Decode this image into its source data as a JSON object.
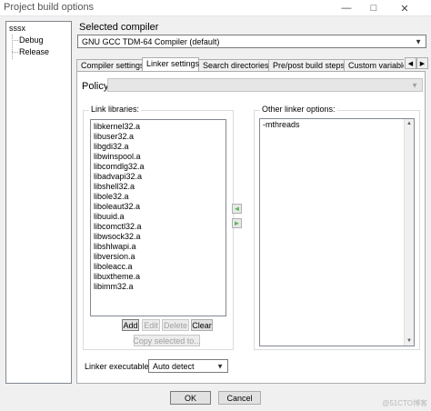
{
  "window": {
    "title": "Project build options"
  },
  "tree": {
    "root": "sssx",
    "children": [
      "Debug",
      "Release"
    ]
  },
  "compiler": {
    "label": "Selected compiler",
    "value": "GNU GCC TDM-64 Compiler (default)"
  },
  "tabs": [
    "Compiler settings",
    "Linker settings",
    "Search directories",
    "Pre/post build steps",
    "Custom variable"
  ],
  "active_tab": "Linker settings",
  "policy": {
    "label": "Policy:",
    "value": ""
  },
  "link_libraries": {
    "label": "Link libraries:",
    "items": [
      "libkernel32.a",
      "libuser32.a",
      "libgdi32.a",
      "libwinspool.a",
      "libcomdlg32.a",
      "libadvapi32.a",
      "libshell32.a",
      "libole32.a",
      "liboleaut32.a",
      "libuuid.a",
      "libcomctl32.a",
      "libwsock32.a",
      "libshlwapi.a",
      "libversion.a",
      "liboleacc.a",
      "libuxtheme.a",
      "libimm32.a"
    ]
  },
  "buttons": {
    "add": "Add",
    "edit": "Edit",
    "delete": "Delete",
    "clear": "Clear",
    "copy_selected": "Copy selected to..."
  },
  "other_options": {
    "label": "Other linker options:",
    "value": "-mthreads"
  },
  "linker_executable": {
    "label": "Linker executable:",
    "value": "Auto detect"
  },
  "dialog": {
    "ok": "OK",
    "cancel": "Cancel"
  },
  "watermark": "@51CTO博客"
}
